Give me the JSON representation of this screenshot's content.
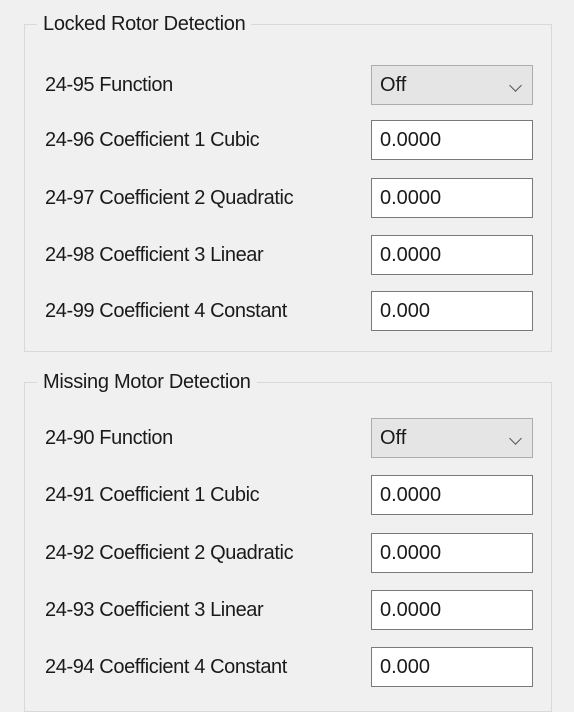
{
  "locked_rotor": {
    "title": "Locked Rotor Detection",
    "function_label": "24-95 Function",
    "function_value": "Off",
    "coef1_label": "24-96 Coefficient 1 Cubic",
    "coef1_value": "0.0000",
    "coef2_label": "24-97 Coefficient 2 Quadratic",
    "coef2_value": "0.0000",
    "coef3_label": "24-98 Coefficient 3 Linear",
    "coef3_value": "0.0000",
    "coef4_label": "24-99 Coefficient 4 Constant",
    "coef4_value": "0.000"
  },
  "missing_motor": {
    "title": "Missing Motor Detection",
    "function_label": "24-90 Function",
    "function_value": "Off",
    "coef1_label": "24-91 Coefficient 1 Cubic",
    "coef1_value": "0.0000",
    "coef2_label": "24-92 Coefficient 2 Quadratic",
    "coef2_value": "0.0000",
    "coef3_label": "24-93 Coefficient 3 Linear",
    "coef3_value": "0.0000",
    "coef4_label": "24-94 Coefficient 4 Constant",
    "coef4_value": "0.000"
  },
  "icons": {
    "dropdown": "chevron-down-icon"
  }
}
